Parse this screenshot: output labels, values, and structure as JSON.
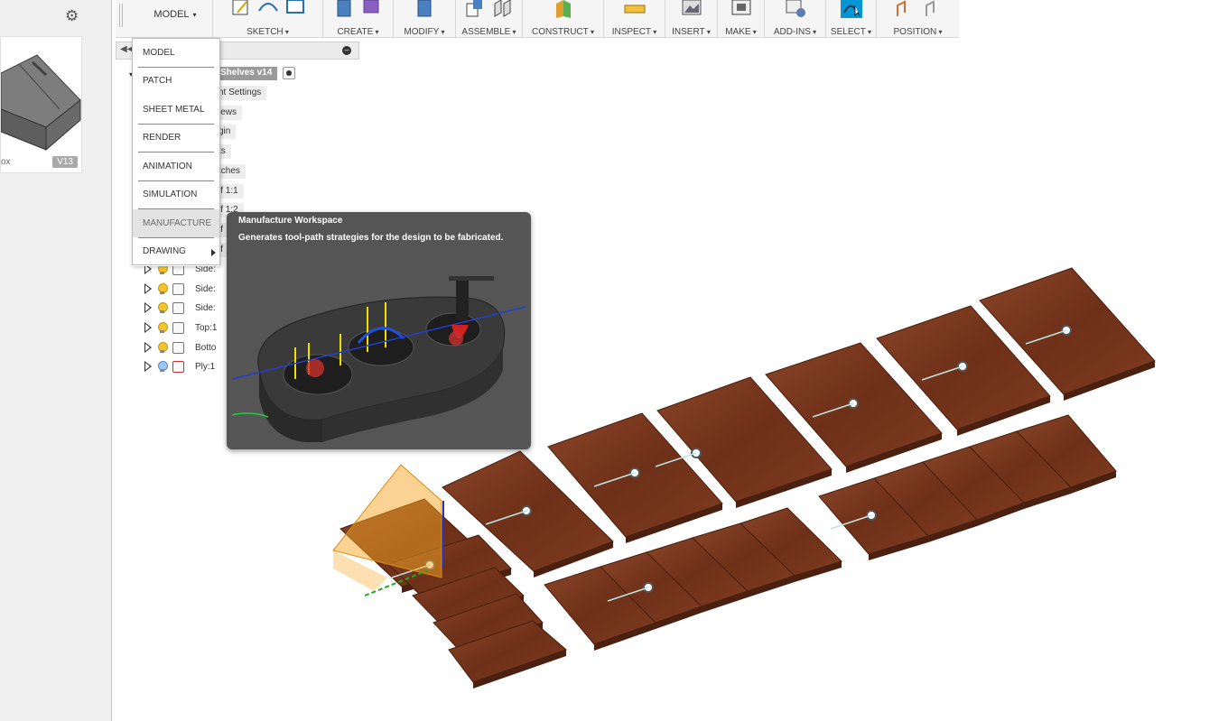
{
  "left_panel": {
    "thumbnail": {
      "name": "ox",
      "version": "V13"
    }
  },
  "toolbar": {
    "workspace_label": "MODEL",
    "groups": [
      {
        "label": "SKETCH"
      },
      {
        "label": "CREATE"
      },
      {
        "label": "MODIFY"
      },
      {
        "label": "ASSEMBLE"
      },
      {
        "label": "CONSTRUCT"
      },
      {
        "label": "INSPECT"
      },
      {
        "label": "INSERT"
      },
      {
        "label": "MAKE"
      },
      {
        "label": "ADD-INS"
      },
      {
        "label": "SELECT"
      },
      {
        "label": "POSITION"
      }
    ]
  },
  "browser": {
    "root": "Shelves v14",
    "nodes": [
      "nt Settings",
      "iews",
      "gin",
      "ts",
      "tches",
      "lf 1:1",
      "lf 1:2",
      "lf",
      "lf"
    ],
    "bodies": [
      "Side:",
      "Side:",
      "Side:",
      "Top:1",
      "Botto",
      "Ply:1"
    ]
  },
  "workspace_menu": {
    "items": [
      "MODEL",
      "PATCH",
      "SHEET METAL",
      "RENDER",
      "ANIMATION",
      "SIMULATION",
      "MANUFACTURE",
      "DRAWING"
    ],
    "active": "MANUFACTURE"
  },
  "tooltip": {
    "title": "Manufacture Workspace",
    "description": "Generates tool-path strategies for the design to be fabricated."
  },
  "colors": {
    "wood": "#7a3a20",
    "wood_edge": "#4a2010",
    "select_blue": "#0696d7",
    "plane_orange": "#f5a623"
  }
}
